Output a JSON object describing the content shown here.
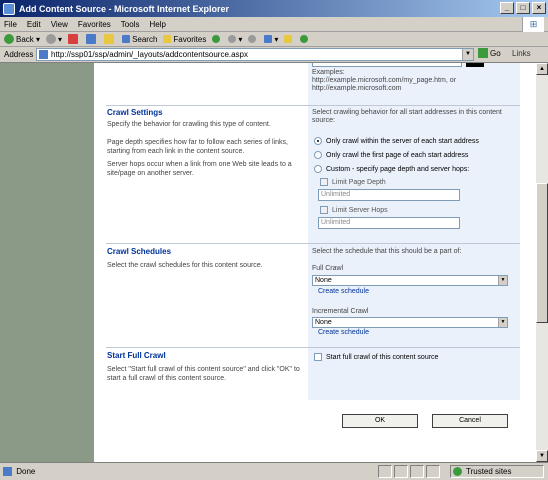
{
  "window": {
    "title": "Add Content Source - Microsoft Internet Explorer"
  },
  "menu": [
    "File",
    "Edit",
    "View",
    "Favorites",
    "Tools",
    "Help"
  ],
  "toolbar": {
    "back": "Back",
    "search": "Search",
    "favorites": "Favorites"
  },
  "address": {
    "label": "Address",
    "url": "http://ssp01/ssp/admin/_layouts/addcontentsource.aspx",
    "go": "Go",
    "links": "Links"
  },
  "top": {
    "examples_label": "Examples:",
    "example1": "http://example.microsoft.com/my_page.htm, or",
    "example2": "http://example.microsoft.com"
  },
  "crawl_settings": {
    "title": "Crawl Settings",
    "desc1": "Specify the behavior for crawling this type of content.",
    "desc2": "Page depth specifies how far to follow each series of links, starting from each link in the content source.",
    "desc3": "Server hops occur when a link from one Web site leads to a site/page on another server.",
    "instruction": "Select crawling behavior for all start addresses in this content source:",
    "options": [
      "Only crawl within the server of each start address",
      "Only crawl the first page of each start address",
      "Custom - specify page depth and server hops:"
    ],
    "selected_index": 0,
    "limit_page_depth": "Limit Page Depth",
    "page_depth_value": "Unlimited",
    "limit_server_hops": "Limit Server Hops",
    "server_hops_value": "Unlimited"
  },
  "crawl_schedules": {
    "title": "Crawl Schedules",
    "desc": "Select the crawl schedules for this content source.",
    "instruction": "Select the schedule that this should be a part of:",
    "full_label": "Full Crawl",
    "full_value": "None",
    "full_link": "Create schedule",
    "incremental_label": "Incremental Crawl",
    "incremental_value": "None",
    "incremental_link": "Create schedule"
  },
  "start_full_crawl": {
    "title": "Start Full Crawl",
    "desc": "Select \"Start full crawl of this content source\" and click \"OK\" to start a full crawl of this content source.",
    "checkbox_label": "Start full crawl of this content source"
  },
  "buttons": {
    "ok": "OK",
    "cancel": "Cancel"
  },
  "status": {
    "done": "Done",
    "zone": "Trusted sites"
  }
}
